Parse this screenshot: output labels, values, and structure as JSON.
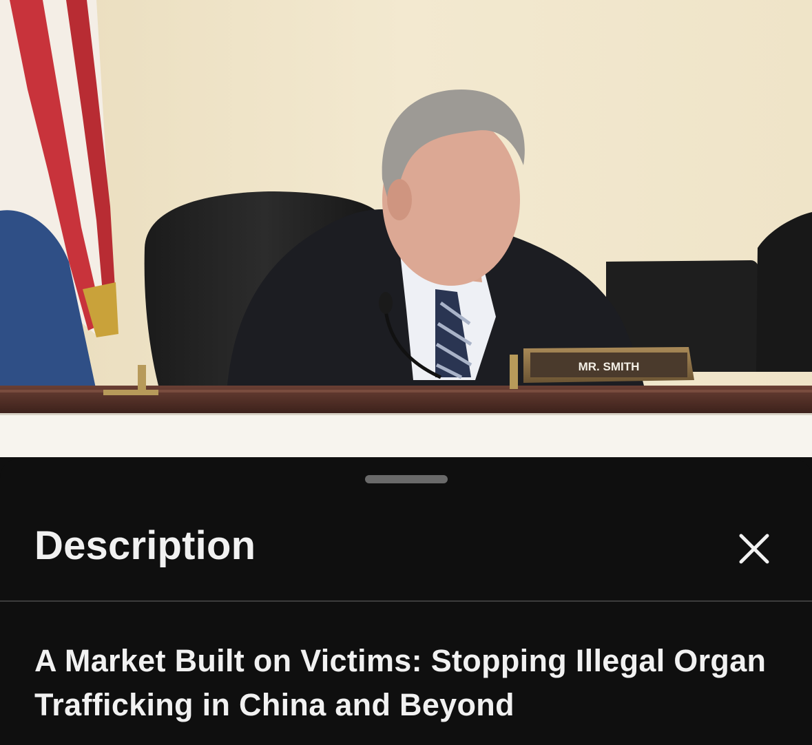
{
  "video": {
    "nameplate_text": "MR. SMITH"
  },
  "sheet": {
    "title": "Description",
    "close_icon": "close-icon",
    "video_title": "A Market Built on Victims: Stopping Illegal Organ Trafficking in China and Beyond"
  },
  "colors": {
    "sheet_background": "#0f0f0f",
    "text_primary": "#f1f1f1",
    "divider": "#3d3d3d",
    "drag_handle": "#6a6a6a"
  }
}
